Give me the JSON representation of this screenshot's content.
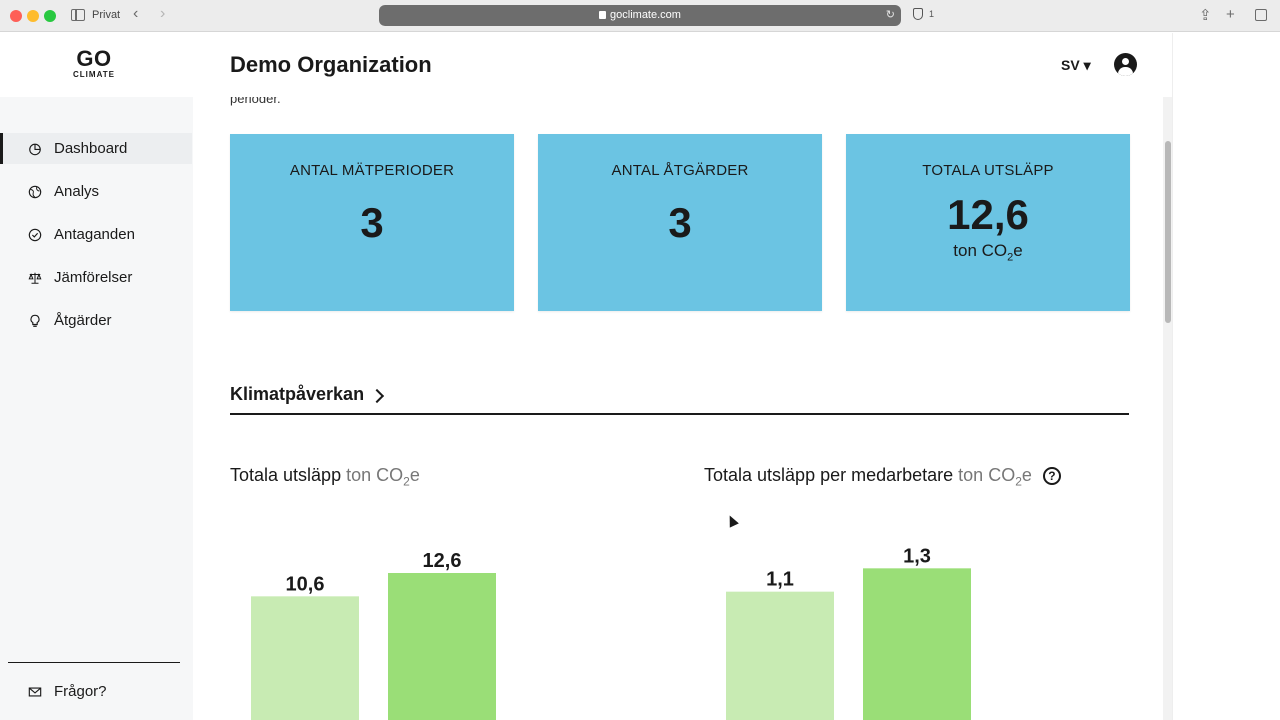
{
  "browser": {
    "private_label": "Privat",
    "url": "goclimate.com",
    "tab_count": "1"
  },
  "header": {
    "logo_top": "GO",
    "logo_bottom": "CLIMATE",
    "org_title": "Demo Organization",
    "language": "SV ▾"
  },
  "sidebar": {
    "items": [
      {
        "label": "Dashboard",
        "icon": "pie-chart-icon",
        "active": true
      },
      {
        "label": "Analys",
        "icon": "globe-icon",
        "active": false
      },
      {
        "label": "Antaganden",
        "icon": "check-circle-icon",
        "active": false
      },
      {
        "label": "Jämförelser",
        "icon": "scale-icon",
        "active": false
      },
      {
        "label": "Åtgärder",
        "icon": "lightbulb-icon",
        "active": false
      }
    ],
    "faq": {
      "label": "Frågor?",
      "icon": "mail-icon"
    }
  },
  "main": {
    "partial_text": "perioder.",
    "cards": [
      {
        "label": "ANTAL MÄTPERIODER",
        "value": "3"
      },
      {
        "label": "ANTAL ÅTGÄRDER",
        "value": "3"
      },
      {
        "label": "TOTALA UTSLÄPP",
        "value": "12,6",
        "unit_prefix": "ton CO",
        "unit_sub": "2",
        "unit_suffix": "e"
      }
    ],
    "section_heading": "Klimatpåverkan",
    "chart_left_title": "Totala utsläpp",
    "chart_right_title": "Totala utsläpp per medarbetare",
    "unit_prefix": "ton CO",
    "unit_sub": "2",
    "unit_suffix": "e",
    "help_glyph": "?"
  },
  "colors": {
    "card_bg": "#6bc4e3",
    "bar_light": "#c8ebb3",
    "bar_dark": "#9ade77"
  },
  "chart_data": [
    {
      "type": "bar",
      "title": "Totala utsläpp ton CO2e",
      "categories": [
        "",
        ""
      ],
      "values": [
        10.6,
        12.6
      ],
      "labels": [
        "10,6",
        "12,6"
      ],
      "ylim": [
        0,
        15
      ]
    },
    {
      "type": "bar",
      "title": "Totala utsläpp per medarbetare ton CO2e",
      "categories": [
        "",
        ""
      ],
      "values": [
        1.1,
        1.3
      ],
      "labels": [
        "1,1",
        "1,3"
      ],
      "ylim": [
        0,
        1.5
      ]
    }
  ]
}
